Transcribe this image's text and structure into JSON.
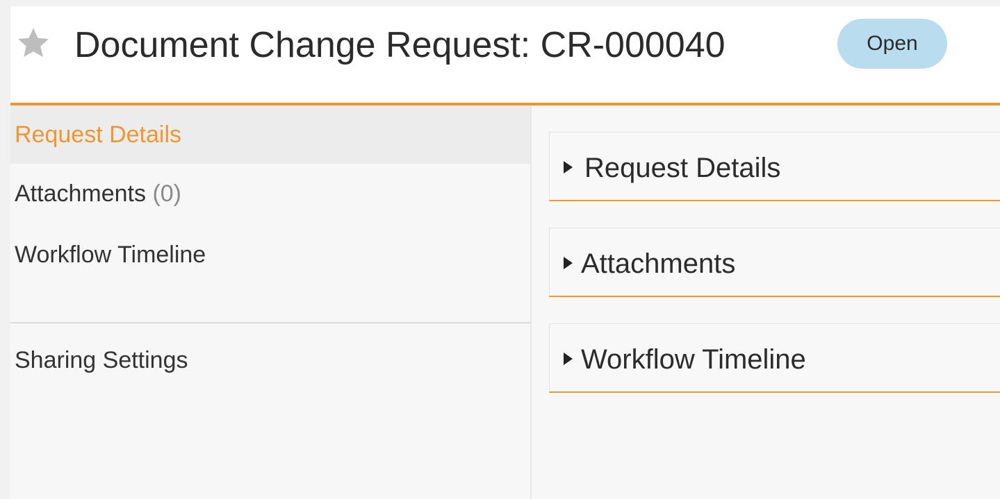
{
  "header": {
    "title": "Document Change Request: CR-000040",
    "status": "Open",
    "favorite_icon": "star-icon"
  },
  "sidebar": {
    "items": [
      {
        "label": "Request Details",
        "active": true
      },
      {
        "label": "Attachments",
        "count": "(0)"
      },
      {
        "label": "Workflow Timeline"
      },
      {
        "label": "Sharing Settings"
      }
    ]
  },
  "sections": [
    {
      "title": "Request Details",
      "icon": "caret-right-icon"
    },
    {
      "title": "Attachments",
      "icon": "caret-right-icon"
    },
    {
      "title": "Workflow Timeline",
      "icon": "caret-right-icon"
    }
  ],
  "colors": {
    "accent": "#f0962f",
    "status_badge": "#b9dcef",
    "star": "#bdbdbd"
  }
}
